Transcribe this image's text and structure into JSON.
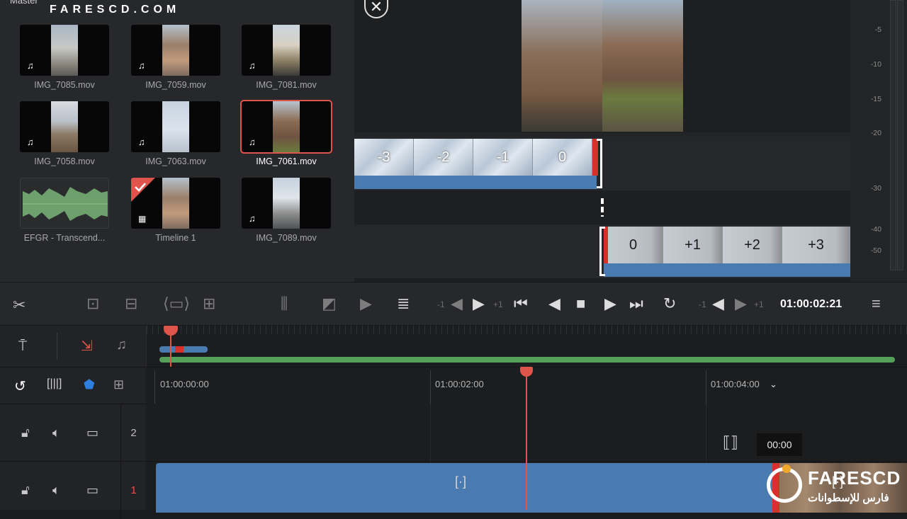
{
  "media_pool": {
    "title": "Master",
    "watermark": "FARESCD.COM",
    "clips": [
      {
        "name": "IMG_7085.mov",
        "icon": "music-note-icon"
      },
      {
        "name": "IMG_7059.mov",
        "icon": "music-note-icon"
      },
      {
        "name": "IMG_7081.mov",
        "icon": "music-note-icon"
      },
      {
        "name": "IMG_7058.mov",
        "icon": "music-note-icon"
      },
      {
        "name": "IMG_7063.mov",
        "icon": "music-note-icon"
      },
      {
        "name": "IMG_7061.mov",
        "icon": "music-note-icon",
        "selected": true
      },
      {
        "name": "EFGR - Transcend...",
        "icon": "audio-waveform"
      },
      {
        "name": "Timeline 1",
        "icon": "timeline-icon"
      },
      {
        "name": "IMG_7089.mov",
        "icon": "music-note-icon"
      }
    ]
  },
  "viewer": {
    "trim_outgoing_labels": [
      "-3",
      "-2",
      "-1",
      "0"
    ],
    "trim_incoming_labels": [
      "0",
      "+1",
      "+2",
      "+3"
    ]
  },
  "meters": {
    "scale": [
      "-5",
      "-10",
      "-15",
      "-20",
      "-30",
      "-40",
      "-50"
    ]
  },
  "toolbar": {
    "nudge_left": "-1",
    "nudge_right": "+1",
    "nudge_left2": "-1",
    "nudge_right2": "+1",
    "timecode": "01:00:02:21"
  },
  "timeline": {
    "ruler": [
      "01:00:00:00",
      "01:00:02:00",
      "01:00:04:00"
    ],
    "tracks": [
      {
        "number": "2"
      },
      {
        "number": "1"
      }
    ],
    "transition_duration": "00:00"
  },
  "logo": {
    "name": "FARESCD",
    "arabic": "فارس للإسطوانات",
    "site": "FARESCD.COM"
  },
  "colors": {
    "accent_red": "#e0554b",
    "clip_blue": "#4a7bb0",
    "audio_green": "#55a05b"
  }
}
